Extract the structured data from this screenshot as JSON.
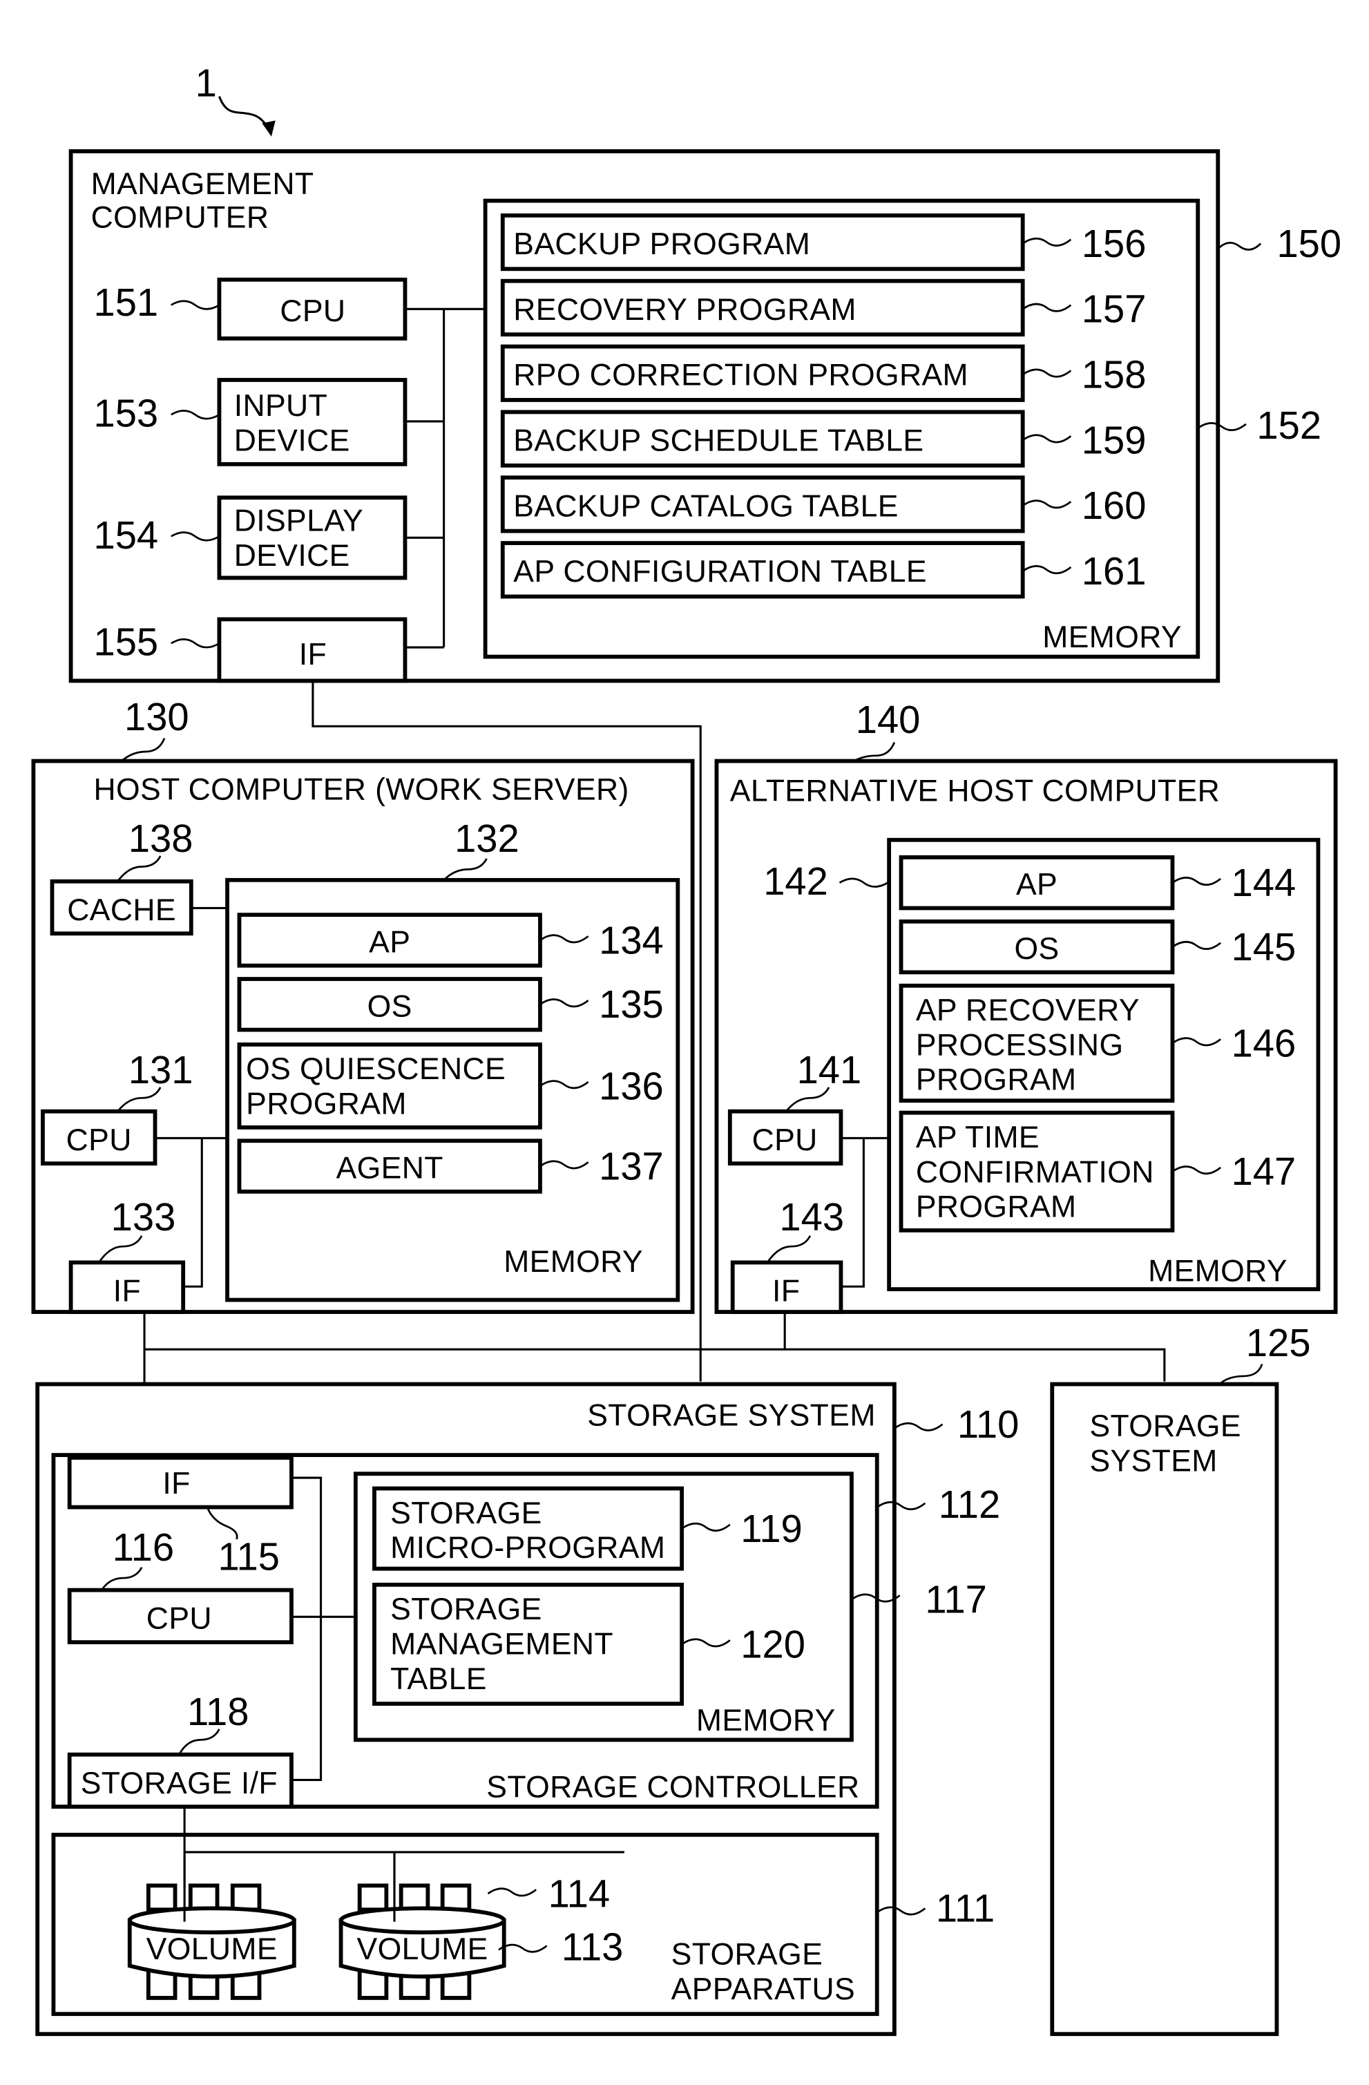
{
  "figure": {
    "system_ref": "1",
    "management_computer": {
      "ref": "150",
      "title_lines": [
        "MANAGEMENT",
        "COMPUTER"
      ],
      "cpu": {
        "ref": "151",
        "label": "CPU"
      },
      "input_device": {
        "ref": "153",
        "lines": [
          "INPUT",
          "DEVICE"
        ]
      },
      "display_device": {
        "ref": "154",
        "lines": [
          "DISPLAY",
          "DEVICE"
        ]
      },
      "if": {
        "ref": "155",
        "label": "IF"
      },
      "memory": {
        "ref": "152",
        "label": "MEMORY",
        "items": [
          {
            "ref": "156",
            "label": "BACKUP PROGRAM"
          },
          {
            "ref": "157",
            "label": "RECOVERY PROGRAM"
          },
          {
            "ref": "158",
            "label": "RPO CORRECTION PROGRAM"
          },
          {
            "ref": "159",
            "label": "BACKUP SCHEDULE TABLE"
          },
          {
            "ref": "160",
            "label": "BACKUP CATALOG TABLE"
          },
          {
            "ref": "161",
            "label": "AP CONFIGURATION TABLE"
          }
        ]
      }
    },
    "host_computer": {
      "ref": "130",
      "title": "HOST COMPUTER (WORK SERVER)",
      "cache": {
        "ref": "138",
        "label": "CACHE"
      },
      "cpu": {
        "ref": "131",
        "label": "CPU"
      },
      "if": {
        "ref": "133",
        "label": "IF"
      },
      "memory": {
        "ref": "132",
        "label": "MEMORY",
        "items": [
          {
            "ref": "134",
            "lines": [
              "AP"
            ]
          },
          {
            "ref": "135",
            "lines": [
              "OS"
            ]
          },
          {
            "ref": "136",
            "lines": [
              "OS QUIESCENCE",
              "PROGRAM"
            ]
          },
          {
            "ref": "137",
            "lines": [
              "AGENT"
            ]
          }
        ]
      }
    },
    "alternative_host": {
      "ref": "140",
      "title": "ALTERNATIVE HOST COMPUTER",
      "cpu": {
        "ref": "141",
        "label": "CPU"
      },
      "if": {
        "ref": "143",
        "label": "IF"
      },
      "memory": {
        "ref": "142",
        "label": "MEMORY",
        "items": [
          {
            "ref": "144",
            "lines": [
              "AP"
            ]
          },
          {
            "ref": "145",
            "lines": [
              "OS"
            ]
          },
          {
            "ref": "146",
            "lines": [
              "AP RECOVERY",
              "PROCESSING",
              "PROGRAM"
            ]
          },
          {
            "ref": "147",
            "lines": [
              "AP TIME",
              "CONFIRMATION",
              "PROGRAM"
            ]
          }
        ]
      }
    },
    "storage_system": {
      "ref": "110",
      "title": "STORAGE SYSTEM",
      "controller": {
        "ref": "112",
        "label": "STORAGE CONTROLLER",
        "if": {
          "ref": "115",
          "label": "IF"
        },
        "cpu": {
          "ref": "116",
          "label": "CPU"
        },
        "storage_if": {
          "ref": "118",
          "label": "STORAGE I/F"
        },
        "memory": {
          "ref": "117",
          "label": "MEMORY",
          "items": [
            {
              "ref": "119",
              "lines": [
                "STORAGE",
                "MICRO-PROGRAM"
              ]
            },
            {
              "ref": "120",
              "lines": [
                "STORAGE",
                "MANAGEMENT",
                "TABLE"
              ]
            }
          ]
        }
      },
      "apparatus": {
        "ref": "111",
        "lines": [
          "STORAGE",
          "APPARATUS"
        ],
        "volume_label": "VOLUME",
        "volume_ref": "113",
        "disk_ref": "114"
      }
    },
    "other_storage": {
      "ref": "125",
      "lines": [
        "STORAGE",
        "SYSTEM"
      ]
    }
  }
}
